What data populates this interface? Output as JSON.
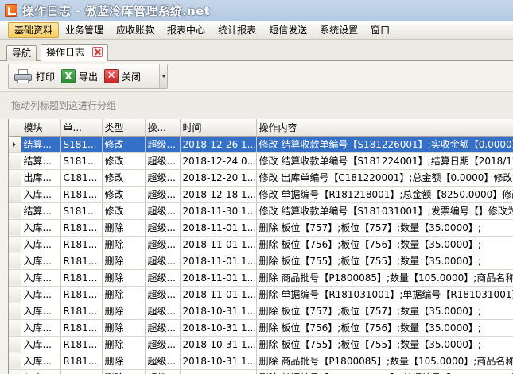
{
  "window": {
    "title": "操作日志 - 傲蓝冷库管理系统.net"
  },
  "menu": {
    "items": [
      "基础资料",
      "业务管理",
      "应收账款",
      "报表中心",
      "统计报表",
      "短信发送",
      "系统设置",
      "窗口"
    ],
    "active_index": 0
  },
  "tabs": {
    "nav_label": "导航",
    "log_label": "操作日志"
  },
  "toolbar": {
    "print_label": "打印",
    "export_label": "导出",
    "close_label": "关闭"
  },
  "group_panel": {
    "hint": "拖动列标题到这进行分组"
  },
  "grid": {
    "columns": [
      "模块",
      "单...",
      "类型",
      "操...",
      "时间",
      "操作内容"
    ],
    "rows": [
      [
        "结算...",
        "S181...",
        "修改",
        "超级...",
        "2018-12-26 1...",
        "修改 结算收款单编号【S181226001】;实收金额【0.0000】"
      ],
      [
        "结算...",
        "S181...",
        "修改",
        "超级...",
        "2018-12-24 0...",
        "修改 结算收款单编号【S181224001】;结算日期【2018/12"
      ],
      [
        "出库...",
        "C181...",
        "修改",
        "超级...",
        "2018-12-20 1...",
        "修改 出库单编号【C181220001】;总金额【0.0000】修改为"
      ],
      [
        "入库...",
        "R181...",
        "修改",
        "超级...",
        "2018-12-18 1...",
        "修改 单据编号【R181218001】;总金额【8250.0000】修改"
      ],
      [
        "结算...",
        "S181...",
        "修改",
        "超级...",
        "2018-11-30 1...",
        "修改 结算收款单编号【S181031001】;发票编号【】修改为"
      ],
      [
        "入库...",
        "R181...",
        "删除",
        "超级...",
        "2018-11-01 1...",
        "删除 板位【757】;板位【757】;数量【35.0000】;"
      ],
      [
        "入库...",
        "R181...",
        "删除",
        "超级...",
        "2018-11-01 1...",
        "删除 板位【756】;板位【756】;数量【35.0000】;"
      ],
      [
        "入库...",
        "R181...",
        "删除",
        "超级...",
        "2018-11-01 1...",
        "删除 板位【755】;板位【755】;数量【35.0000】;"
      ],
      [
        "入库...",
        "R181...",
        "删除",
        "超级...",
        "2018-11-01 1...",
        "删除 商品批号【P1800085】;数量【105.0000】;商品名称"
      ],
      [
        "入库...",
        "R181...",
        "删除",
        "超级...",
        "2018-11-01 1...",
        "删除 单据编号【R181031001】;单据编号【R181031001】"
      ],
      [
        "入库...",
        "R181...",
        "删除",
        "超级...",
        "2018-10-31 1...",
        "删除 板位【757】;板位【757】;数量【35.0000】;"
      ],
      [
        "入库...",
        "R181...",
        "删除",
        "超级...",
        "2018-10-31 1...",
        "删除 板位【756】;板位【756】;数量【35.0000】;"
      ],
      [
        "入库...",
        "R181...",
        "删除",
        "超级...",
        "2018-10-31 1...",
        "删除 板位【755】;板位【755】;数量【35.0000】;"
      ],
      [
        "入库...",
        "R181...",
        "删除",
        "超级...",
        "2018-10-31 1...",
        "删除 商品批号【P1800085】;数量【105.0000】;商品名称"
      ],
      [
        "入库...",
        "R181...",
        "删除",
        "超级...",
        "2018-10-31 1...",
        "删除 单据编号【R181031001】;单据编号【R181031001】"
      ]
    ],
    "selected_row": 0
  }
}
